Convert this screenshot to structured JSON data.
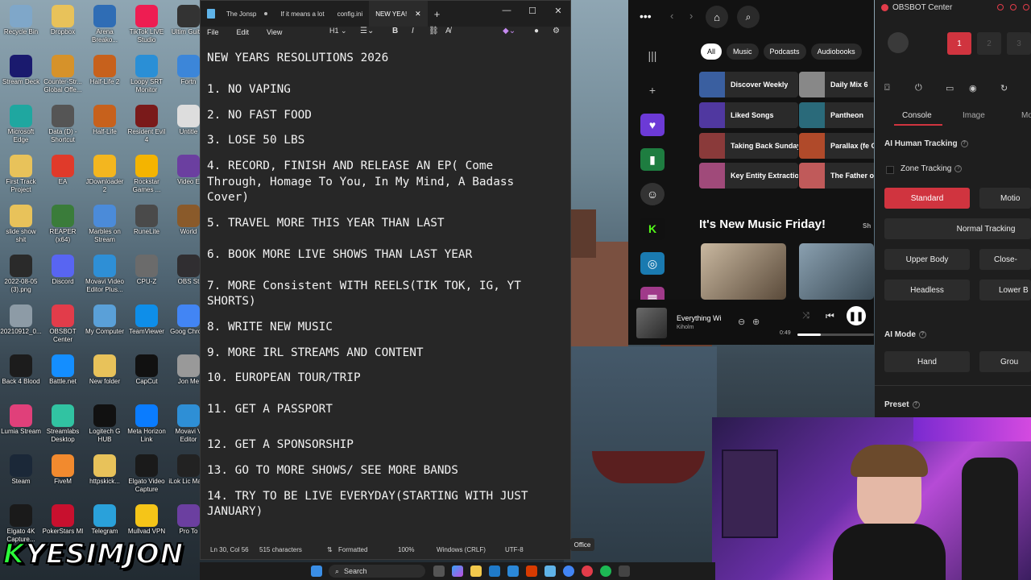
{
  "desktop": {
    "icons": [
      {
        "label": "Recycle Bin",
        "icon": "recycle-bin-icon",
        "color": "#7fa7c9"
      },
      {
        "label": "Dropbox",
        "icon": "folder-icon",
        "color": "#e8c25a"
      },
      {
        "label": "Arena Breako...",
        "icon": "app-icon",
        "color": "#2f6db5"
      },
      {
        "label": "TikTok LIVE Studio",
        "icon": "tiktok-icon",
        "color": "#ee1d52"
      },
      {
        "label": "Ultim Guitar",
        "icon": "guitar-icon",
        "color": "#333333"
      },
      {
        "label": "Stream Deck",
        "icon": "stream-deck-icon",
        "color": "#1a1a6e"
      },
      {
        "label": "Counter-Str... Global Offe...",
        "icon": "csgo-icon",
        "color": "#d6922a"
      },
      {
        "label": "Half-Life 2",
        "icon": "half-life-icon",
        "color": "#c7611c"
      },
      {
        "label": "Loopy SRT Monitor",
        "icon": "monitor-icon",
        "color": "#2a8fd6"
      },
      {
        "label": "Fortn",
        "icon": "fortnite-icon",
        "color": "#3c86d9"
      },
      {
        "label": "Microsoft Edge",
        "icon": "edge-icon",
        "color": "#1fa7a0"
      },
      {
        "label": "Data (D) - Shortcut",
        "icon": "drive-icon",
        "color": "#555555"
      },
      {
        "label": "Half-Life",
        "icon": "half-life-icon",
        "color": "#c7611c"
      },
      {
        "label": "Resident Evil 4",
        "icon": "resident-evil-icon",
        "color": "#7a1a1a"
      },
      {
        "label": "Untitle",
        "icon": "file-icon",
        "color": "#dddddd"
      },
      {
        "label": "First Track Project",
        "icon": "folder-icon",
        "color": "#e8c25a"
      },
      {
        "label": "EA",
        "icon": "ea-icon",
        "color": "#e03a2a"
      },
      {
        "label": "JDownloader 2",
        "icon": "jdownloader-icon",
        "color": "#f3b61f"
      },
      {
        "label": "Rockstar Games ...",
        "icon": "rockstar-icon",
        "color": "#f4b400"
      },
      {
        "label": "Video E",
        "icon": "video-icon",
        "color": "#6b3fa0"
      },
      {
        "label": "slide show shit",
        "icon": "folder-icon",
        "color": "#e8c25a"
      },
      {
        "label": "REAPER (x64)",
        "icon": "reaper-icon",
        "color": "#3a7c3a"
      },
      {
        "label": "Marbles on Stream",
        "icon": "marbles-icon",
        "color": "#4b8bd9"
      },
      {
        "label": "RuneLite",
        "icon": "runelite-icon",
        "color": "#4a4a4a"
      },
      {
        "label": "World",
        "icon": "game-icon",
        "color": "#8a5a2a"
      },
      {
        "label": "2022-08-05 (3).png",
        "icon": "image-file-icon",
        "color": "#2a2a2a"
      },
      {
        "label": "Discord",
        "icon": "discord-icon",
        "color": "#5865f2"
      },
      {
        "label": "Movavi Video Editor Plus...",
        "icon": "movavi-icon",
        "color": "#2e8fd6"
      },
      {
        "label": "CPU-Z",
        "icon": "cpuz-icon",
        "color": "#6b6b6b"
      },
      {
        "label": "OBS St",
        "icon": "obs-icon",
        "color": "#302e31"
      },
      {
        "label": "20210912_0...",
        "icon": "image-file-icon",
        "color": "#8d9ba6"
      },
      {
        "label": "OBSBOT Center",
        "icon": "obsbot-icon",
        "color": "#e23c4a"
      },
      {
        "label": "My Computer",
        "icon": "computer-icon",
        "color": "#5aa0d8"
      },
      {
        "label": "TeamViewer",
        "icon": "teamviewer-icon",
        "color": "#0e8ee9"
      },
      {
        "label": "Goog Chrom",
        "icon": "chrome-icon",
        "color": "#4285f4"
      },
      {
        "label": "Back 4 Blood",
        "icon": "game-icon",
        "color": "#1c1c1c"
      },
      {
        "label": "Battle.net",
        "icon": "battlenet-icon",
        "color": "#148eff"
      },
      {
        "label": "New folder",
        "icon": "folder-icon",
        "color": "#e8c25a"
      },
      {
        "label": "CapCut",
        "icon": "capcut-icon",
        "color": "#111111"
      },
      {
        "label": "Jon Me",
        "icon": "file-icon",
        "color": "#999999"
      },
      {
        "label": "Lumia Stream",
        "icon": "lumia-icon",
        "color": "#e0407a"
      },
      {
        "label": "Streamlabs Desktop",
        "icon": "streamlabs-icon",
        "color": "#31c3a2"
      },
      {
        "label": "Logitech G HUB",
        "icon": "logitech-icon",
        "color": "#111111"
      },
      {
        "label": "Meta Horizon Link",
        "icon": "meta-icon",
        "color": "#0a7cff"
      },
      {
        "label": "Movavi V Editor",
        "icon": "movavi-icon",
        "color": "#2e8fd6"
      },
      {
        "label": "Steam",
        "icon": "steam-icon",
        "color": "#1b2838"
      },
      {
        "label": "FiveM",
        "icon": "fivem-icon",
        "color": "#f28a2e"
      },
      {
        "label": "httpskick...",
        "icon": "folder-icon",
        "color": "#e8c25a"
      },
      {
        "label": "Elgato Video Capture",
        "icon": "elgato-icon",
        "color": "#1a1a1a"
      },
      {
        "label": "iLok Lic Mana",
        "icon": "ilok-icon",
        "color": "#222222"
      },
      {
        "label": "Elgato 4K Capture...",
        "icon": "elgato-icon",
        "color": "#1a1a1a"
      },
      {
        "label": "PokerStars MI",
        "icon": "pokerstars-icon",
        "color": "#c8102e"
      },
      {
        "label": "Telegram",
        "icon": "telegram-icon",
        "color": "#2aa1da"
      },
      {
        "label": "Mullvad VPN",
        "icon": "vpn-icon",
        "color": "#f5c518"
      },
      {
        "label": "Pro To",
        "icon": "app-icon",
        "color": "#6b3fa0"
      }
    ],
    "watermark": "KYESIMJON"
  },
  "notepad": {
    "tabs": [
      {
        "label": "The Jonsp",
        "active": false
      },
      {
        "label": "If it means a lot",
        "active": false
      },
      {
        "label": "config.ini",
        "active": false
      },
      {
        "label": "NEW YEA!",
        "active": true
      }
    ],
    "menu": {
      "file": "File",
      "edit": "Edit",
      "view": "View",
      "heading": "H1"
    },
    "lines": [
      "NEW YEARS RESOLUTIONS 2026",
      "1. NO VAPING",
      "2. NO FAST FOOD",
      "3. LOSE 50 LBS",
      "4. RECORD, FINISH AND RELEASE AN EP( Come",
      "Through, Homage To You, In My Mind, A Badass",
      "Cover)",
      "5. TRAVEL MORE THIS YEAR THAN LAST",
      "6. BOOK MORE LIVE SHOWS THAN LAST YEAR",
      "7. MORE Consistent WITH REELS(TIK TOK, IG, YT",
      "SHORTS)",
      "8. WRITE NEW MUSIC",
      "9. MORE IRL STREAMS AND CONTENT",
      "10. EUROPEAN TOUR/TRIP",
      "11. GET A PASSPORT",
      "12. GET A SPONSORSHIP",
      "13. GO TO MORE SHOWS/ SEE MORE BANDS",
      "14. TRY TO BE LIVE EVERYDAY(STARTING WITH JUST",
      "JANUARY)"
    ],
    "status": {
      "position": "Ln 30, Col 56",
      "characters": "515 characters",
      "format": "Formatted",
      "zoom": "100%",
      "line_ending": "Windows (CRLF)",
      "encoding": "UTF-8"
    }
  },
  "spotify": {
    "chips": [
      "All",
      "Music",
      "Podcasts",
      "Audiobooks"
    ],
    "cards": [
      {
        "title": "Discover Weekly",
        "color": "#3a5fa0"
      },
      {
        "title": "Daily Mix 6",
        "color": "#888888"
      },
      {
        "title": "Liked Songs",
        "color": "#5038a0"
      },
      {
        "title": "Pantheon",
        "color": "#2a6a7a"
      },
      {
        "title": "Taking Back Sunday Radio",
        "color": "#8a3a3a"
      },
      {
        "title": "Parallax (fe Owane) Ra",
        "color": "#b04a2a"
      },
      {
        "title": "Key Entity Extraction VIII ...",
        "color": "#a04a7a"
      },
      {
        "title": "The Father o Make Believe",
        "color": "#c05a5a"
      }
    ],
    "section_title": "It's New Music Friday!",
    "show_all": "Sh",
    "player": {
      "track": "Everything Wi",
      "artist": "Kiholm",
      "elapsed": "0:49",
      "progress": 0.3
    }
  },
  "obsbot": {
    "title": "OBSBOT Center",
    "slots": [
      "1",
      "2",
      "3"
    ],
    "tabs": [
      "Console",
      "Image",
      "Mo"
    ],
    "ai_tracking_label": "AI Human Tracking",
    "zone_tracking_label": "Zone Tracking",
    "buttons": {
      "standard": "Standard",
      "motion": "Motio",
      "normal_tracking": "Normal Tracking",
      "upper_body": "Upper Body",
      "close_up": "Close-",
      "headless": "Headless",
      "lower_body": "Lower B",
      "hand": "Hand",
      "group": "Grou"
    },
    "ai_mode_label": "AI Mode",
    "preset_label": "Preset",
    "accent": "#d0343f"
  },
  "taskbar": {
    "search_label": "Search",
    "tooltip": "Office"
  }
}
